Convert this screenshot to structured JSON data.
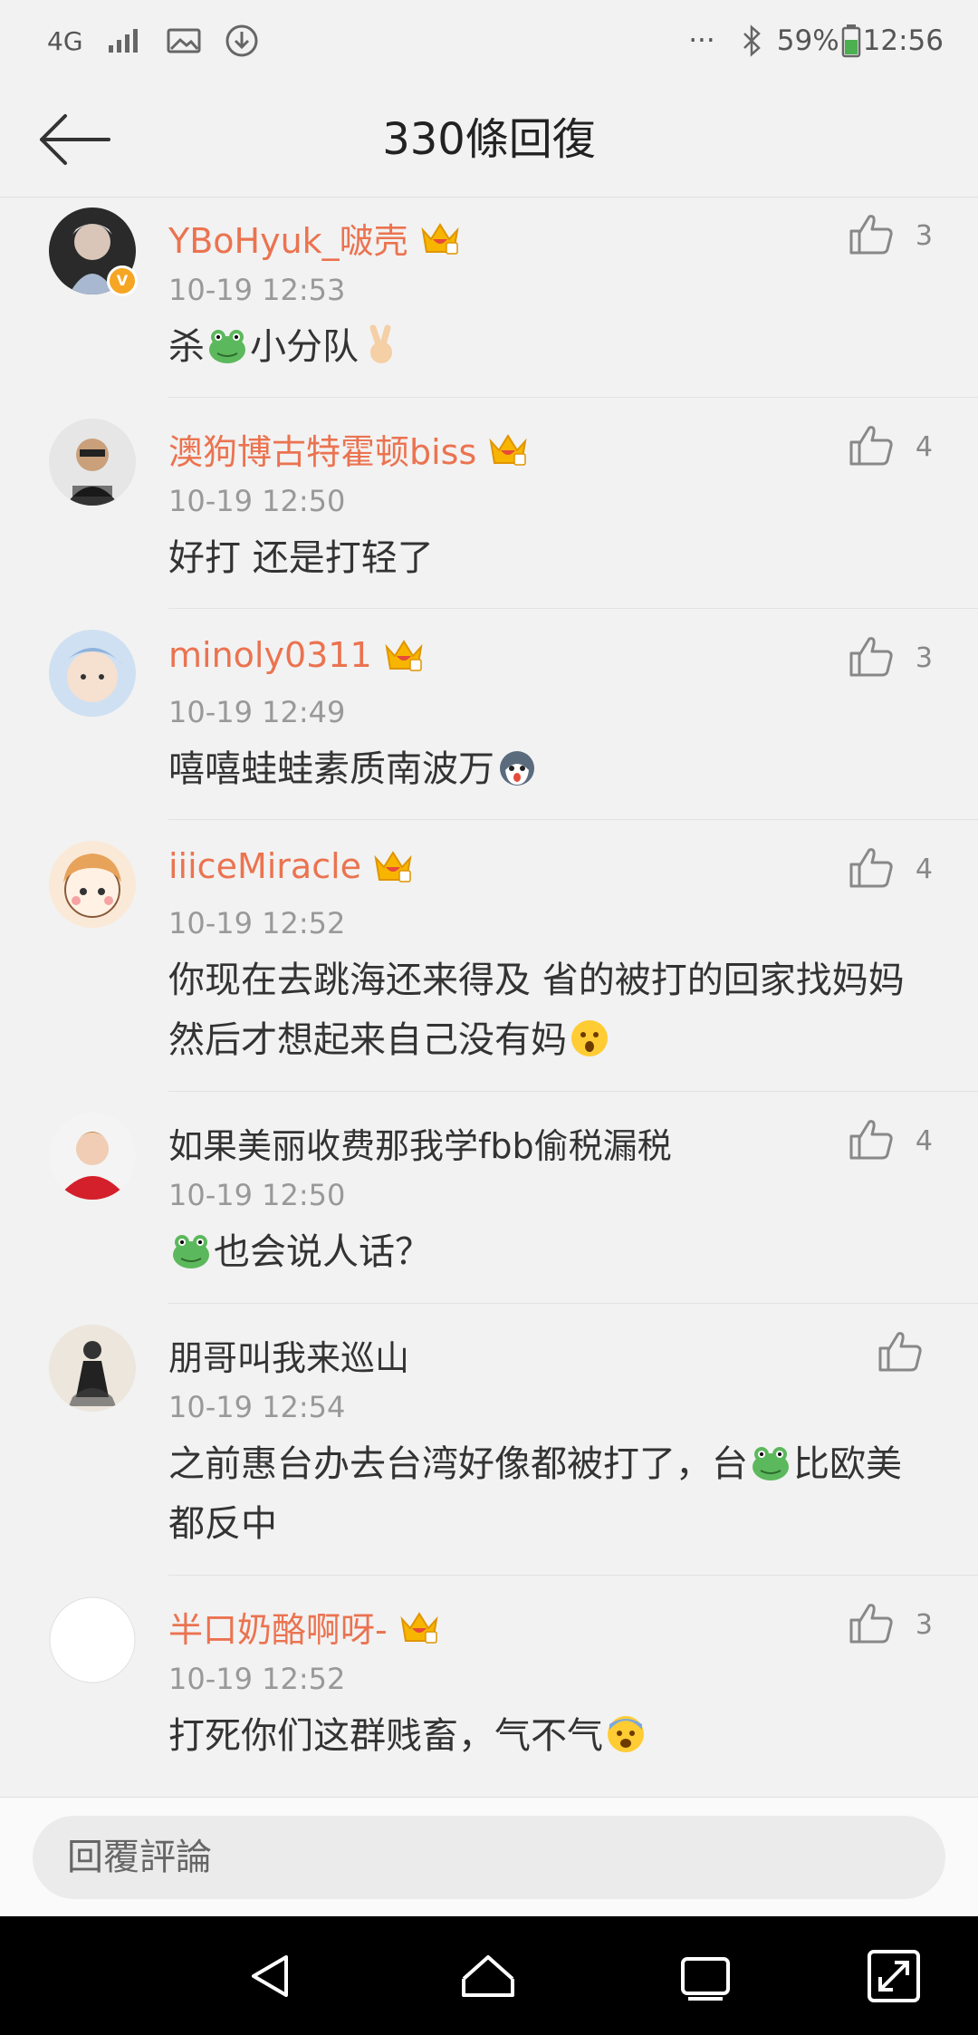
{
  "status_bar": {
    "network": "4G",
    "dots": "···",
    "battery": "59%",
    "time": "12:56"
  },
  "header": {
    "title": "330條回復"
  },
  "comments": [
    {
      "name": "YBoHyuk_啵壳",
      "time": "10-19 12:53",
      "body": "杀🐸小分队✌️",
      "likes": "3",
      "vip": true
    },
    {
      "name": "澳狗博古特霍顿biss",
      "time": "10-19 12:50",
      "body": "好打 还是打轻了",
      "likes": "4",
      "vip": true
    },
    {
      "name": "minoly0311",
      "time": "10-19 12:49",
      "body": "嘻嘻蛙蛙素质南波万🐶",
      "likes": "3",
      "vip": true
    },
    {
      "name": "iiiceMiracle",
      "time": "10-19 12:52",
      "body": "你现在去跳海还来得及 省的被打的回家找妈妈然后才想起来自己没有妈😲",
      "likes": "4",
      "vip": true
    },
    {
      "name": "如果美丽收费那我学fbb偷税漏税",
      "time": "10-19 12:50",
      "body": "🐸也会说人话？",
      "likes": "4",
      "vip": false
    },
    {
      "name": "朋哥叫我来巡山",
      "time": "10-19 12:54",
      "body": "之前惠台办去台湾好像都被打了，台🐸比欧美都反中",
      "likes": "",
      "vip": false
    },
    {
      "name": "半口奶酪啊呀-",
      "time": "10-19 12:52",
      "body": "打死你们这群贱畜，气不气😱",
      "likes": "3",
      "vip": true
    }
  ],
  "reply": {
    "placeholder": "回覆評論"
  },
  "colors": {
    "vip_name": "#eb7350",
    "timestamp": "#999999",
    "background": "#f2f2f2"
  }
}
